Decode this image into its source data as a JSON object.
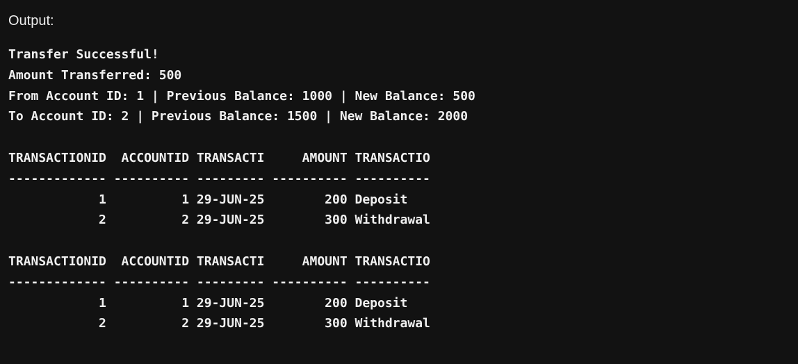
{
  "output_label": "Output:",
  "console": {
    "lines": [
      "Transfer Successful!",
      "Amount Transferred: 500",
      "From Account ID: 1 | Previous Balance: 1000 | New Balance: 500",
      "To Account ID: 2 | Previous Balance: 1500 | New Balance: 2000",
      "",
      "TRANSACTIONID  ACCOUNTID TRANSACTI     AMOUNT TRANSACTIO",
      "------------- ---------- --------- ---------- ----------",
      "            1          1 29-JUN-25        200 Deposit",
      "            2          2 29-JUN-25        300 Withdrawal",
      "",
      "TRANSACTIONID  ACCOUNTID TRANSACTI     AMOUNT TRANSACTIO",
      "------------- ---------- --------- ---------- ----------",
      "            1          1 29-JUN-25        200 Deposit",
      "            2          2 29-JUN-25        300 Withdrawal"
    ]
  }
}
